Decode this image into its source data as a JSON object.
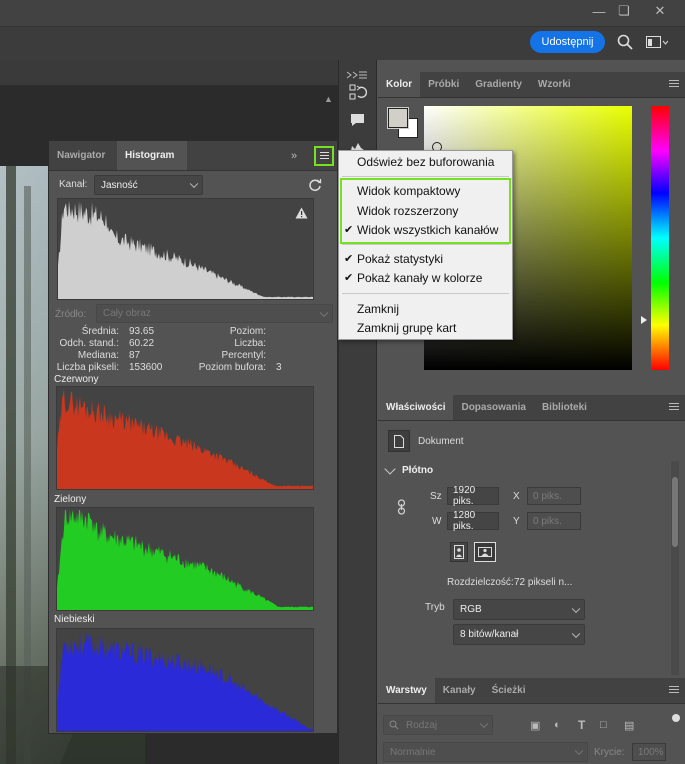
{
  "topbar": {
    "share_label": "Udostępnij",
    "window_controls": [
      "minimize-icon",
      "restore-icon",
      "close-icon"
    ]
  },
  "histogram_panel": {
    "tabs": [
      "Nawigator",
      "Histogram"
    ],
    "active_tab": "Histogram",
    "channel_label": "Kanał:",
    "channel_value": "Jasność",
    "source_label": "Źródło:",
    "source_value": "Cały obraz",
    "stats": {
      "mean_label": "Średnia:",
      "mean": "93.65",
      "stddev_label": "Odch. stand.:",
      "stddev": "60.22",
      "median_label": "Mediana:",
      "median": "87",
      "pixels_label": "Liczba pikseli:",
      "pixels": "153600",
      "level_label": "Poziom:",
      "count_label": "Liczba:",
      "percentile_label": "Percentyl:",
      "cache_label": "Poziom bufora:",
      "cache": "3"
    },
    "channels": [
      {
        "name": "Czerwony",
        "color": "#c8371e"
      },
      {
        "name": "Zielony",
        "color": "#22cc22"
      },
      {
        "name": "Niebieski",
        "color": "#2a2ad8"
      }
    ],
    "luminosity_color": "#cfcfcf"
  },
  "flyout_menu": {
    "items": [
      {
        "label": "Odśwież bez buforowania",
        "checked": false
      },
      {
        "label": "Widok kompaktowy",
        "checked": false
      },
      {
        "label": "Widok rozszerzony",
        "checked": false
      },
      {
        "label": "Widok wszystkich kanałów",
        "checked": true
      },
      {
        "label": "Pokaż statystyki",
        "checked": true
      },
      {
        "label": "Pokaż kanały w kolorze",
        "checked": true
      },
      {
        "label": "Zamknij",
        "checked": false
      },
      {
        "label": "Zamknij grupę kart",
        "checked": false
      }
    ],
    "highlight_color": "#78e022"
  },
  "color_panel": {
    "tabs": [
      "Kolor",
      "Próbki",
      "Gradienty",
      "Wzorki"
    ],
    "active_tab": "Kolor",
    "hue_color": "#e8ff00"
  },
  "properties_panel": {
    "tabs": [
      "Właściwości",
      "Dopasowania",
      "Biblioteki"
    ],
    "active_tab": "Właściwości",
    "doc_label": "Dokument",
    "section": "Płótno",
    "w_label": "Sz",
    "w_value": "1920 piks.",
    "h_label": "W",
    "h_value": "1280 piks.",
    "x_label": "X",
    "x_value": "0 piks.",
    "y_label": "Y",
    "y_value": "0 piks.",
    "resolution_label": "Rozdzielczość:",
    "resolution_value": "72 pikseli n...",
    "mode_label": "Tryb",
    "mode_value": "RGB",
    "depth_value": "8 bitów/kanał"
  },
  "layers_panel": {
    "tabs": [
      "Warstwy",
      "Kanały",
      "Ścieżki"
    ],
    "active_tab": "Warstwy",
    "filter_value": "Rodzaj",
    "blend_value": "Normalnie",
    "opacity_label": "Krycie:",
    "opacity_value": "100%"
  }
}
